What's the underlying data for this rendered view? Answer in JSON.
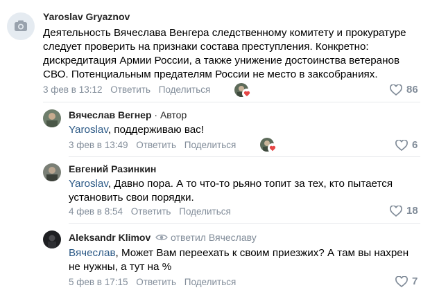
{
  "comments": [
    {
      "author": "Yaroslav Gryaznov",
      "text": "Деятельность Вячеслава Венгера следственному комитету и прокуратуре следует проверить на признаки состава преступления. Конкретно: дискредитация Армии России, а также унижение достоинства ветеранов СВО. Потенциальным предателям России не место в заксобраниях.",
      "date": "3 фев в 13:12",
      "reply": "Ответить",
      "share": "Поделиться",
      "likes": "86"
    },
    {
      "author": "Вячеслав Вегнер",
      "role": " · Автор",
      "mention": "Yaroslav",
      "text": ", поддерживаю вас!",
      "date": "3 фев в 13:49",
      "reply": "Ответить",
      "share": "Поделиться",
      "likes": "6"
    },
    {
      "author": "Евгений Разинкин",
      "mention": "Yaroslav",
      "text": ", Давно пора. А то что-то рьяно топит за тех, кто пытается установить свои порядки.",
      "date": "4 фев в 8:54",
      "reply": "Ответить",
      "share": "Поделиться",
      "likes": "18"
    },
    {
      "author": "Aleksandr Klimov",
      "replied_to": "ответил Вячеславу",
      "mention": "Вячеслав",
      "text": ", Может Вам переехать к своим приезжих? А там вы нахрен не нужны, а тут на %",
      "date": "5 фев в 17:15",
      "reply": "Ответить",
      "share": "Поделиться",
      "likes": "7"
    }
  ],
  "colors": {
    "link": "#2a5885",
    "meta": "#818c99",
    "heart": "#e64646"
  },
  "icons": {
    "camera": "camera-icon",
    "heart": "heart-icon",
    "eye": "eye-icon"
  }
}
